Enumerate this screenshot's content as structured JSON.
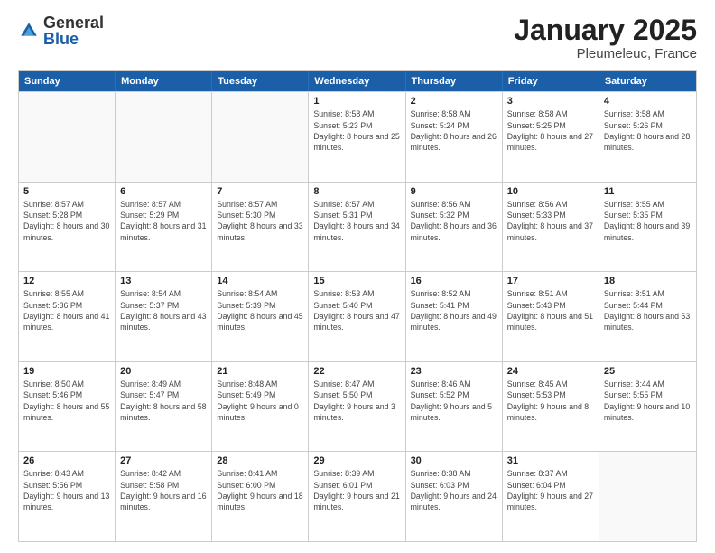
{
  "logo": {
    "general": "General",
    "blue": "Blue"
  },
  "title": "January 2025",
  "location": "Pleumeleuc, France",
  "days": [
    "Sunday",
    "Monday",
    "Tuesday",
    "Wednesday",
    "Thursday",
    "Friday",
    "Saturday"
  ],
  "rows": [
    [
      {
        "day": "",
        "empty": true
      },
      {
        "day": "",
        "empty": true
      },
      {
        "day": "",
        "empty": true
      },
      {
        "day": "1",
        "sunrise": "8:58 AM",
        "sunset": "5:23 PM",
        "daylight": "8 hours and 25 minutes."
      },
      {
        "day": "2",
        "sunrise": "8:58 AM",
        "sunset": "5:24 PM",
        "daylight": "8 hours and 26 minutes."
      },
      {
        "day": "3",
        "sunrise": "8:58 AM",
        "sunset": "5:25 PM",
        "daylight": "8 hours and 27 minutes."
      },
      {
        "day": "4",
        "sunrise": "8:58 AM",
        "sunset": "5:26 PM",
        "daylight": "8 hours and 28 minutes."
      }
    ],
    [
      {
        "day": "5",
        "sunrise": "8:57 AM",
        "sunset": "5:28 PM",
        "daylight": "8 hours and 30 minutes."
      },
      {
        "day": "6",
        "sunrise": "8:57 AM",
        "sunset": "5:29 PM",
        "daylight": "8 hours and 31 minutes."
      },
      {
        "day": "7",
        "sunrise": "8:57 AM",
        "sunset": "5:30 PM",
        "daylight": "8 hours and 33 minutes."
      },
      {
        "day": "8",
        "sunrise": "8:57 AM",
        "sunset": "5:31 PM",
        "daylight": "8 hours and 34 minutes."
      },
      {
        "day": "9",
        "sunrise": "8:56 AM",
        "sunset": "5:32 PM",
        "daylight": "8 hours and 36 minutes."
      },
      {
        "day": "10",
        "sunrise": "8:56 AM",
        "sunset": "5:33 PM",
        "daylight": "8 hours and 37 minutes."
      },
      {
        "day": "11",
        "sunrise": "8:55 AM",
        "sunset": "5:35 PM",
        "daylight": "8 hours and 39 minutes."
      }
    ],
    [
      {
        "day": "12",
        "sunrise": "8:55 AM",
        "sunset": "5:36 PM",
        "daylight": "8 hours and 41 minutes."
      },
      {
        "day": "13",
        "sunrise": "8:54 AM",
        "sunset": "5:37 PM",
        "daylight": "8 hours and 43 minutes."
      },
      {
        "day": "14",
        "sunrise": "8:54 AM",
        "sunset": "5:39 PM",
        "daylight": "8 hours and 45 minutes."
      },
      {
        "day": "15",
        "sunrise": "8:53 AM",
        "sunset": "5:40 PM",
        "daylight": "8 hours and 47 minutes."
      },
      {
        "day": "16",
        "sunrise": "8:52 AM",
        "sunset": "5:41 PM",
        "daylight": "8 hours and 49 minutes."
      },
      {
        "day": "17",
        "sunrise": "8:51 AM",
        "sunset": "5:43 PM",
        "daylight": "8 hours and 51 minutes."
      },
      {
        "day": "18",
        "sunrise": "8:51 AM",
        "sunset": "5:44 PM",
        "daylight": "8 hours and 53 minutes."
      }
    ],
    [
      {
        "day": "19",
        "sunrise": "8:50 AM",
        "sunset": "5:46 PM",
        "daylight": "8 hours and 55 minutes."
      },
      {
        "day": "20",
        "sunrise": "8:49 AM",
        "sunset": "5:47 PM",
        "daylight": "8 hours and 58 minutes."
      },
      {
        "day": "21",
        "sunrise": "8:48 AM",
        "sunset": "5:49 PM",
        "daylight": "9 hours and 0 minutes."
      },
      {
        "day": "22",
        "sunrise": "8:47 AM",
        "sunset": "5:50 PM",
        "daylight": "9 hours and 3 minutes."
      },
      {
        "day": "23",
        "sunrise": "8:46 AM",
        "sunset": "5:52 PM",
        "daylight": "9 hours and 5 minutes."
      },
      {
        "day": "24",
        "sunrise": "8:45 AM",
        "sunset": "5:53 PM",
        "daylight": "9 hours and 8 minutes."
      },
      {
        "day": "25",
        "sunrise": "8:44 AM",
        "sunset": "5:55 PM",
        "daylight": "9 hours and 10 minutes."
      }
    ],
    [
      {
        "day": "26",
        "sunrise": "8:43 AM",
        "sunset": "5:56 PM",
        "daylight": "9 hours and 13 minutes."
      },
      {
        "day": "27",
        "sunrise": "8:42 AM",
        "sunset": "5:58 PM",
        "daylight": "9 hours and 16 minutes."
      },
      {
        "day": "28",
        "sunrise": "8:41 AM",
        "sunset": "6:00 PM",
        "daylight": "9 hours and 18 minutes."
      },
      {
        "day": "29",
        "sunrise": "8:39 AM",
        "sunset": "6:01 PM",
        "daylight": "9 hours and 21 minutes."
      },
      {
        "day": "30",
        "sunrise": "8:38 AM",
        "sunset": "6:03 PM",
        "daylight": "9 hours and 24 minutes."
      },
      {
        "day": "31",
        "sunrise": "8:37 AM",
        "sunset": "6:04 PM",
        "daylight": "9 hours and 27 minutes."
      },
      {
        "day": "",
        "empty": true
      }
    ]
  ],
  "labels": {
    "sunrise": "Sunrise:",
    "sunset": "Sunset:",
    "daylight": "Daylight:"
  }
}
